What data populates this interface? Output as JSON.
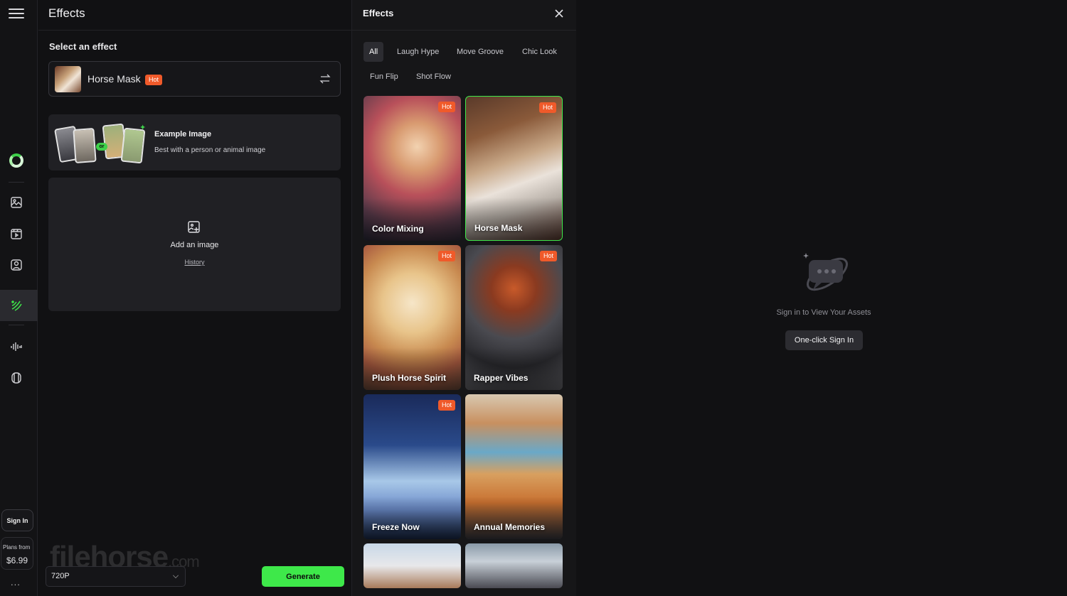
{
  "sidebar": {
    "icons": [
      "menu-icon",
      "logo-icon",
      "image-icon",
      "video-icon",
      "character-icon",
      "effects-icon",
      "audio-icon",
      "cube-icon"
    ],
    "sign_in_label": "Sign In",
    "plans_label": "Plans from",
    "plans_price": "$6.99",
    "more_label": "..."
  },
  "panel": {
    "title": "Effects",
    "select_label": "Select an effect",
    "selected_effect": {
      "name": "Horse Mask",
      "badge": "Hot"
    },
    "example": {
      "or_label": "or",
      "title": "Example Image",
      "subtitle": "Best with a person or animal image"
    },
    "upload": {
      "add_label": "Add an image",
      "history_label": "History"
    },
    "resolution": "720P",
    "generate_label": "Generate",
    "watermark": "filehorse",
    "watermark_suffix": ".com"
  },
  "gallery": {
    "title": "Effects",
    "categories": [
      "All",
      "Laugh Hype",
      "Move Groove",
      "Chic Look",
      "Fun Flip",
      "Shot Flow"
    ],
    "active_category": "All",
    "tiles": [
      {
        "label": "Color Mixing",
        "badge": "Hot",
        "selected": false
      },
      {
        "label": "Horse Mask",
        "badge": "Hot",
        "selected": true
      },
      {
        "label": "Plush Horse Spirit",
        "badge": "Hot",
        "selected": false
      },
      {
        "label": "Rapper Vibes",
        "badge": "Hot",
        "selected": false
      },
      {
        "label": "Freeze Now",
        "badge": "Hot",
        "selected": false
      },
      {
        "label": "Annual Memories",
        "badge": "",
        "selected": false
      },
      {
        "label": "",
        "badge": "",
        "selected": false
      },
      {
        "label": "",
        "badge": "",
        "selected": false
      }
    ]
  },
  "assets": {
    "message": "Sign in to View Your Assets",
    "button_label": "One-click Sign In"
  },
  "colors": {
    "accent": "#3ee84a",
    "hot_badge": "#f05a2a",
    "background": "#111113"
  }
}
